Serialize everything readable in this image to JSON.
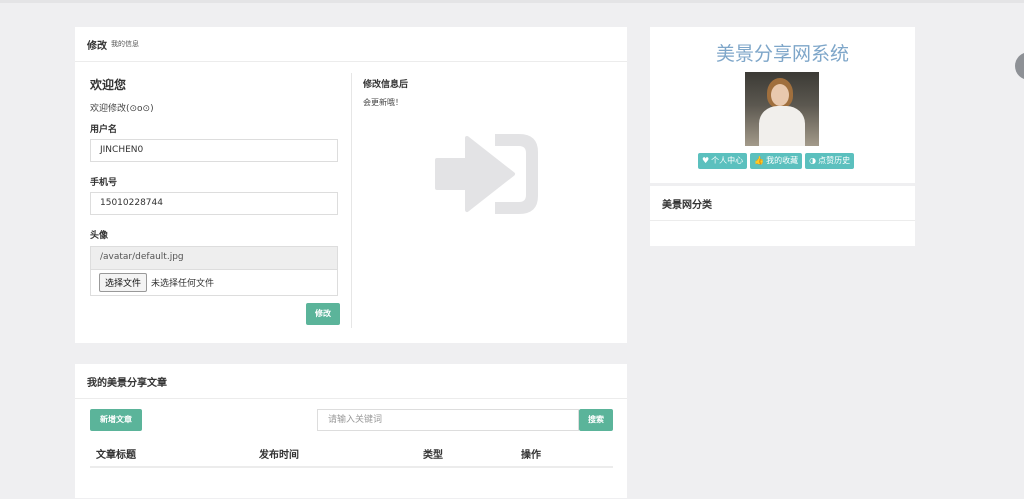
{
  "edit_panel": {
    "title": "修改",
    "subtitle": "我的信息",
    "welcome_title": "欢迎您",
    "welcome_sub": "欢迎修改(⊙o⊙)",
    "username_label": "用户名",
    "username_value": "JINCHEN0",
    "phone_label": "手机号",
    "phone_value": "15010228744",
    "avatar_label": "头像",
    "avatar_path": "/avatar/default.jpg",
    "file_button": "选择文件",
    "file_status": "未选择任何文件",
    "submit_label": "修改",
    "note_title": "修改信息后",
    "note_body": "会更新哦！",
    "icon": "sign-in-icon"
  },
  "articles_panel": {
    "title": "我的美景分享文章",
    "new_button": "新增文章",
    "search_placeholder": "请输入关键词",
    "search_button": "搜索",
    "columns": [
      "文章标题",
      "发布时间",
      "类型",
      "操作"
    ]
  },
  "sidebar": {
    "site_title": "美景分享网系统",
    "tags": [
      {
        "icon": "heart-icon",
        "label": "个人中心"
      },
      {
        "icon": "thumbs-up-icon",
        "label": "我的收藏"
      },
      {
        "icon": "half-circle-icon",
        "label": "点赞历史"
      }
    ],
    "category_title": "美景网分类"
  },
  "colors": {
    "accent_green": "#5bb49a",
    "tag_teal": "#5bc0be",
    "title_blue": "#7ea6c9"
  }
}
